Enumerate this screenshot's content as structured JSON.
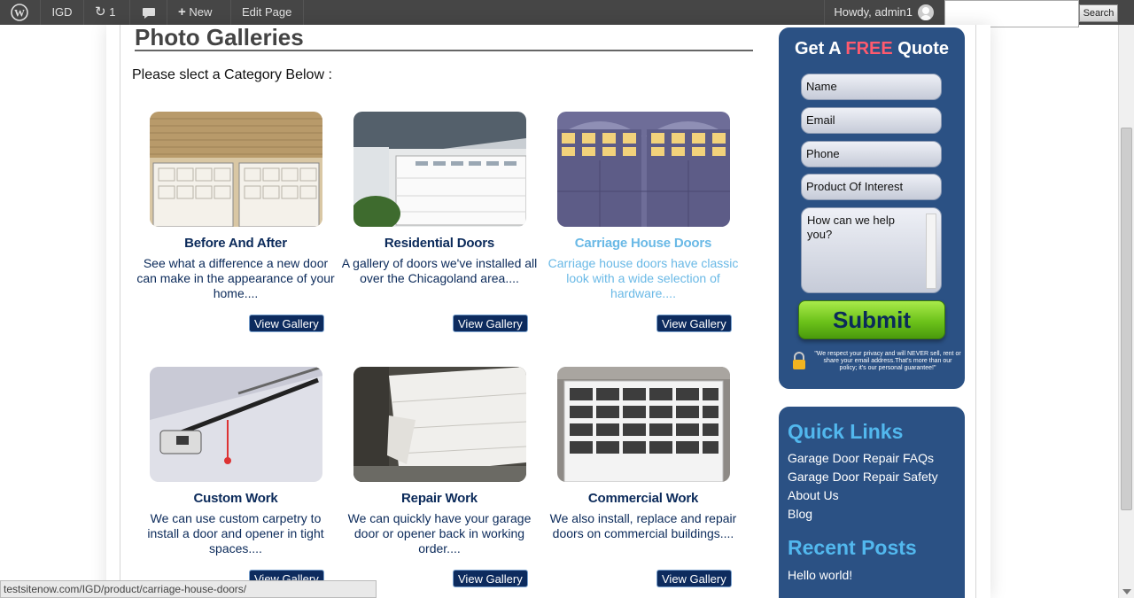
{
  "adminbar": {
    "site": "IGD",
    "updates": "1",
    "new": "New",
    "edit": "Edit Page",
    "howdy": "Howdy, admin1",
    "search_button": "Search"
  },
  "page": {
    "title": "Photo Galleries",
    "intro": "Please slect a Category Below :"
  },
  "cards": [
    {
      "title": "Before And After",
      "desc": "See what a difference a new door can make in the appearance of your home....",
      "button": "View Gallery"
    },
    {
      "title": "Residential Doors",
      "desc": "A gallery of doors we've installed all over the Chicagoland area....",
      "button": "View Gallery"
    },
    {
      "title": "Carriage House Doors",
      "desc": "Carriage house doors have classic look with a wide selection of hardware....",
      "button": "View Gallery"
    },
    {
      "title": "Custom Work",
      "desc": "We can use custom carpetry to install a door and opener in tight spaces....",
      "button": "View Gallery"
    },
    {
      "title": "Repair Work",
      "desc": "We can quickly have your garage door or opener back in working order....",
      "button": "View Gallery"
    },
    {
      "title": "Commercial Work",
      "desc": "We also install, replace and repair doors on commercial buildings....",
      "button": "View Gallery"
    }
  ],
  "quote": {
    "title_pre": "Get A ",
    "title_free": "FREE",
    "title_post": " Quote",
    "fields": [
      "Name",
      "Email",
      "Phone",
      "Product Of Interest"
    ],
    "message_placeholder": "How can we help you?",
    "submit": "Submit",
    "privacy": "\"We respect your privacy and will NEVER sell, rent or share your email address.That's more than our policy; it's our personal guarantee!\""
  },
  "sidebar": {
    "quick_links_title": "Quick Links",
    "quick_links": [
      "Garage Door Repair FAQs",
      "Garage Door Repair Safety",
      "About Us",
      "Blog"
    ],
    "recent_title": "Recent Posts",
    "recent": [
      "Hello world!"
    ]
  },
  "status_url": "testsitenow.com/IGD/product/carriage-house-doors/",
  "colors": {
    "navy": "#0d2b5e",
    "sidebar_blue": "#2b5184",
    "link_blue": "#52b8ee",
    "free_red": "#ff5a6e",
    "submit_green": "#6cc21a"
  }
}
